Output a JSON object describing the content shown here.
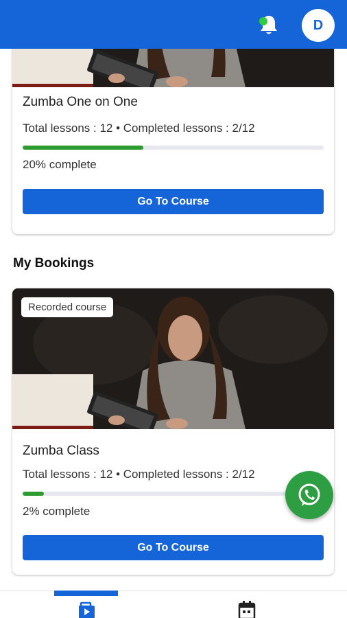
{
  "header": {
    "avatar_initial": "D",
    "notification_icon": "bell-icon",
    "colors": {
      "bar": "#1565d8",
      "notification_dot": "#2ecc40"
    }
  },
  "courses": [
    {
      "title": "Zumba One on One",
      "lessons_text": "Total lessons : 12  •  Completed lessons : 2/12",
      "progress": 0.4,
      "percent_text": "20% complete",
      "button_label": "Go To Course"
    }
  ],
  "bookings_section": {
    "heading": "My Bookings",
    "items": [
      {
        "badge": "Recorded course",
        "title": "Zumba Class",
        "lessons_text": "Total lessons : 12  •  Completed lessons : 2/12",
        "progress": 0.07,
        "percent_text": "2% complete",
        "button_label": "Go To Course"
      }
    ]
  },
  "fab": {
    "icon": "whatsapp-icon",
    "color": "#2e9e42"
  },
  "bottom_nav": {
    "items": [
      {
        "icon": "courses-icon",
        "active": true
      },
      {
        "icon": "calendar-icon",
        "active": false
      }
    ]
  }
}
